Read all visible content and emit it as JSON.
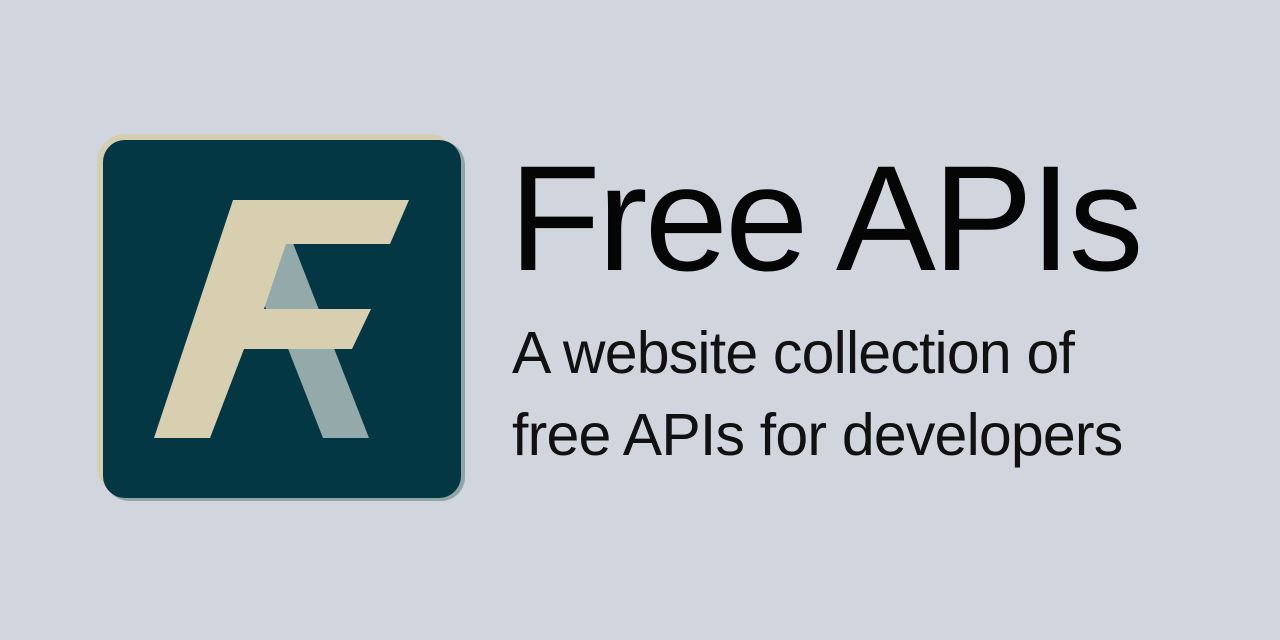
{
  "brand": {
    "logo_name": "free-apis-logo",
    "colors": {
      "background": "#d1d5dd",
      "logo_tile": "#033744",
      "logo_border": "#d5ceb1",
      "logo_shadow": "#91a5a6",
      "logo_letter_a": "#93a9aa",
      "logo_letter_f": "#d8cfb0"
    }
  },
  "hero": {
    "title": "Free APIs",
    "subtitle_lines": [
      "A website collection of",
      "free APIs for developers"
    ]
  }
}
